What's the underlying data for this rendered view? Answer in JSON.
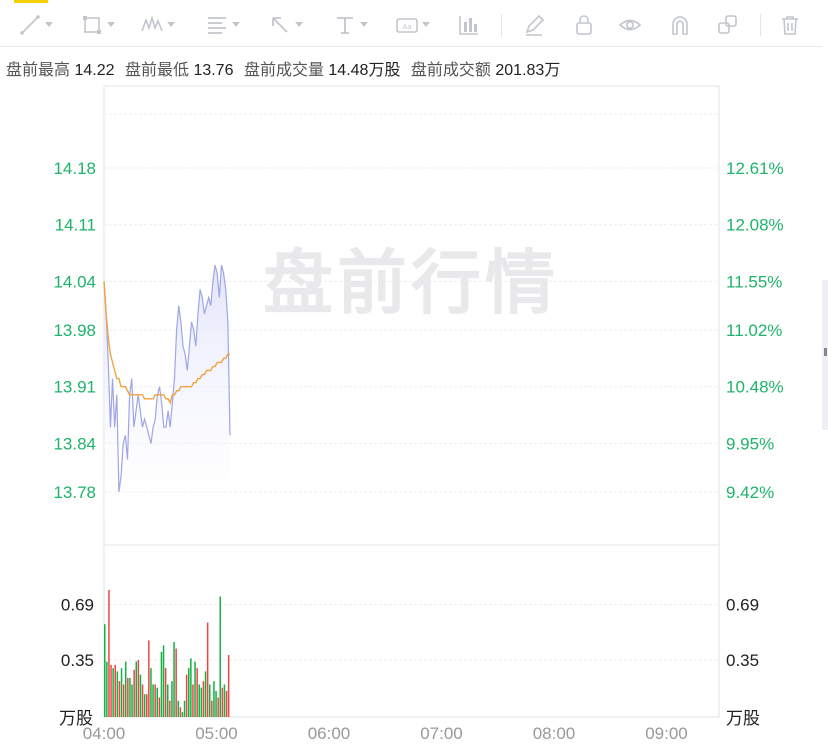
{
  "toolbar": {
    "tools": [
      {
        "icon": "line-tool-icon",
        "has_menu": true
      },
      {
        "icon": "rectangle-tool-icon",
        "has_menu": true
      },
      {
        "icon": "wave-tool-icon",
        "has_menu": true
      },
      {
        "icon": "fibonacci-tool-icon",
        "has_menu": true
      },
      {
        "icon": "arrow-tool-icon",
        "has_menu": true
      },
      {
        "icon": "text-tool-icon",
        "has_menu": true
      },
      {
        "icon": "label-tool-icon",
        "has_menu": true
      },
      {
        "icon": "measure-tool-icon",
        "has_menu": false
      },
      {
        "icon": "pencil-icon",
        "has_menu": false
      },
      {
        "icon": "lock-icon",
        "has_menu": false
      },
      {
        "icon": "eye-icon",
        "has_menu": false
      },
      {
        "icon": "magnet-icon",
        "has_menu": false
      },
      {
        "icon": "layers-icon",
        "has_menu": false
      },
      {
        "icon": "trash-icon",
        "has_menu": false
      }
    ]
  },
  "stats": {
    "high_label": "盘前最高",
    "high_value": "14.22",
    "low_label": "盘前最低",
    "low_value": "13.76",
    "volume_label": "盘前成交量",
    "volume_value": "14.48万股",
    "turnover_label": "盘前成交额",
    "turnover_value": "201.83万"
  },
  "watermark": "盘前行情",
  "colors": {
    "up": "#14b143",
    "down": "#ef4444",
    "price_line": "#9fa5e6",
    "avg_line": "#f4a140",
    "axis_text": "#1fb36a",
    "grid": "#eeeeee"
  },
  "chart_data": {
    "type": "line",
    "price_ticks": [
      "14.18",
      "14.11",
      "14.04",
      "13.98",
      "13.91",
      "13.84",
      "13.78"
    ],
    "pct_ticks": [
      "12.61%",
      "12.08%",
      "11.55%",
      "11.02%",
      "10.48%",
      "9.95%",
      "9.42%"
    ],
    "volume_ticks": [
      "0.69",
      "0.35"
    ],
    "volume_unit": "万股",
    "time_ticks": [
      "04:00",
      "05:00",
      "06:00",
      "07:00",
      "08:00",
      "09:00"
    ],
    "series": [
      {
        "values": [
          14.04,
          14.0,
          13.94,
          13.86,
          13.92,
          13.86,
          13.9,
          13.78,
          13.8,
          13.84,
          13.85,
          13.82,
          13.9,
          13.92,
          13.86,
          13.88,
          13.9,
          13.88,
          13.86,
          13.87,
          13.86,
          13.85,
          13.84,
          13.86,
          13.87,
          13.9,
          13.91,
          13.89,
          13.86,
          13.86,
          13.88,
          13.86,
          13.89,
          13.92,
          13.98,
          14.01,
          13.99,
          13.96,
          13.95,
          13.93,
          13.96,
          13.99,
          13.98,
          13.96,
          14.0,
          14.03,
          14.02,
          14.0,
          14.01,
          14.02,
          14.01,
          14.04,
          14.06,
          14.05,
          14.02,
          14.06,
          14.05,
          14.03,
          13.99,
          13.85
        ]
      },
      {
        "values": [
          14.04,
          14.0,
          13.97,
          13.95,
          13.94,
          13.93,
          13.92,
          13.92,
          13.91,
          13.91,
          13.91,
          13.905,
          13.9,
          13.9,
          13.9,
          13.9,
          13.9,
          13.9,
          13.9,
          13.895,
          13.895,
          13.895,
          13.895,
          13.895,
          13.9,
          13.9,
          13.9,
          13.9,
          13.9,
          13.895,
          13.895,
          13.89,
          13.9,
          13.9,
          13.905,
          13.905,
          13.91,
          13.91,
          13.91,
          13.91,
          13.91,
          13.91,
          13.915,
          13.915,
          13.92,
          13.92,
          13.925,
          13.925,
          13.93,
          13.93,
          13.93,
          13.935,
          13.935,
          13.94,
          13.94,
          13.94,
          13.945,
          13.945,
          13.95,
          13.95
        ]
      }
    ],
    "volume": [
      0.57,
      0.34,
      0.78,
      0.32,
      0.3,
      0.32,
      0.28,
      0.22,
      0.3,
      0.2,
      0.34,
      0.24,
      0.24,
      0.2,
      0.29,
      0.34,
      0.35,
      0.26,
      0.2,
      0.14,
      0.14,
      0.47,
      0.3,
      0.2,
      0.2,
      0.18,
      0.12,
      0.4,
      0.44,
      0.3,
      0.2,
      0.1,
      0.22,
      0.46,
      0.42,
      0.1,
      0.06,
      0.03,
      0.1,
      0.26,
      0.3,
      0.36,
      0.2,
      0.34,
      0.3,
      0.2,
      0.18,
      0.22,
      0.28,
      0.58,
      0.2,
      0.1,
      0.22,
      0.16,
      0.12,
      0.74,
      0.18,
      0.2,
      0.16,
      0.38
    ],
    "volume_dir": [
      1,
      1,
      0,
      0,
      1,
      0,
      1,
      0,
      1,
      0,
      1,
      0,
      1,
      1,
      0,
      1,
      0,
      1,
      0,
      1,
      0,
      0,
      1,
      1,
      0,
      1,
      0,
      1,
      1,
      0,
      1,
      0,
      1,
      1,
      0,
      1,
      0,
      1,
      1,
      0,
      1,
      1,
      0,
      1,
      0,
      1,
      1,
      0,
      1,
      0,
      1,
      0,
      1,
      1,
      0,
      1,
      0,
      1,
      0,
      0
    ],
    "grid": true
  }
}
